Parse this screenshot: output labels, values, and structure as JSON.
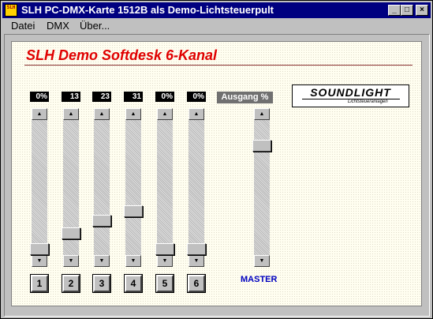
{
  "window": {
    "title": "SLH PC-DMX-Karte 1512B  als Demo-Lichtsteuerpult",
    "icon_text": "SLH",
    "minimize_glyph": "_",
    "maximize_glyph": "□",
    "close_glyph": "×"
  },
  "menu": {
    "items": [
      {
        "label": "Datei"
      },
      {
        "label": "DMX"
      },
      {
        "label": "Über..."
      }
    ]
  },
  "panel": {
    "heading": "SLH Demo Softdesk 6-Kanal",
    "logo_text": "SOUNDLIGHT",
    "logo_subtext": "Lichtsteueranlagen"
  },
  "channels": [
    {
      "display": "0%",
      "button": "1",
      "level_pct": 0
    },
    {
      "display": "13",
      "button": "2",
      "level_pct": 13
    },
    {
      "display": "23",
      "button": "3",
      "level_pct": 23
    },
    {
      "display": "31",
      "button": "4",
      "level_pct": 31
    },
    {
      "display": "0%",
      "button": "5",
      "level_pct": 0
    },
    {
      "display": "0%",
      "button": "6",
      "level_pct": 0
    }
  ],
  "master": {
    "header": "Ausgang %",
    "label": "MASTER",
    "level_pct": 84
  },
  "icons": {
    "scroll_up": "▲",
    "scroll_down": "▼"
  }
}
